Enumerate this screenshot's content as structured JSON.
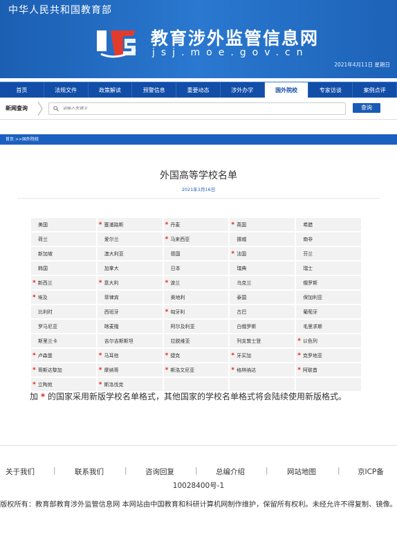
{
  "header": {
    "ministry": "中华人民共和国教育部",
    "site_title": "教育涉外监管信息网",
    "site_url": "jsj.moe.gov.cn",
    "date": "2021年4月11日 星期日",
    "banner_color": "#1b5fb2"
  },
  "nav": {
    "items": [
      "首页",
      "法规文件",
      "政策解读",
      "预警信息",
      "重要动态",
      "涉外办学",
      "国外院校",
      "专家访谈",
      "案例点评"
    ],
    "active": "国外院校"
  },
  "search": {
    "label": "新闻查询",
    "placeholder": "请输入关键字",
    "button": "查询"
  },
  "breadcrumb": "首页 >>国外院校",
  "article": {
    "title": "外国高等学校名单",
    "date": "2021年3月16日"
  },
  "countries": [
    [
      {
        "n": "美国",
        "s": false
      },
      {
        "n": "塞浦路斯",
        "s": true
      },
      {
        "n": "丹麦",
        "s": true
      },
      {
        "n": "英国",
        "s": true
      },
      {
        "n": "希腊",
        "s": false
      }
    ],
    [
      {
        "n": "荷兰",
        "s": false
      },
      {
        "n": "爱尔兰",
        "s": false
      },
      {
        "n": "马来西亚",
        "s": true
      },
      {
        "n": "挪威",
        "s": false
      },
      {
        "n": "南非",
        "s": false
      }
    ],
    [
      {
        "n": "新加坡",
        "s": false
      },
      {
        "n": "澳大利亚",
        "s": false
      },
      {
        "n": "德国",
        "s": false
      },
      {
        "n": "法国",
        "s": true
      },
      {
        "n": "芬兰",
        "s": false
      }
    ],
    [
      {
        "n": "韩国",
        "s": false
      },
      {
        "n": "加拿大",
        "s": false
      },
      {
        "n": "日本",
        "s": false
      },
      {
        "n": "瑞典",
        "s": false
      },
      {
        "n": "瑞士",
        "s": false
      }
    ],
    [
      {
        "n": "新西兰",
        "s": true
      },
      {
        "n": "意大利",
        "s": true
      },
      {
        "n": "波兰",
        "s": true
      },
      {
        "n": "乌克兰",
        "s": false
      },
      {
        "n": "俄罗斯",
        "s": false
      }
    ],
    [
      {
        "n": "埃及",
        "s": true
      },
      {
        "n": "菲律宾",
        "s": false
      },
      {
        "n": "奥地利",
        "s": false
      },
      {
        "n": "泰国",
        "s": false
      },
      {
        "n": "保加利亚",
        "s": false
      }
    ],
    [
      {
        "n": "比利时",
        "s": false
      },
      {
        "n": "西班牙",
        "s": false
      },
      {
        "n": "匈牙利",
        "s": true
      },
      {
        "n": "古巴",
        "s": false
      },
      {
        "n": "葡萄牙",
        "s": false
      }
    ],
    [
      {
        "n": "罗马尼亚",
        "s": false
      },
      {
        "n": "喀麦隆",
        "s": false
      },
      {
        "n": "阿尔及利亚",
        "s": false
      },
      {
        "n": "白俄罗斯",
        "s": false
      },
      {
        "n": "毛里求斯",
        "s": false
      }
    ],
    [
      {
        "n": "斯里兰卡",
        "s": false
      },
      {
        "n": "吉尔吉斯斯坦",
        "s": false
      },
      {
        "n": "拉脱维亚",
        "s": false
      },
      {
        "n": "列支敦士登",
        "s": false
      },
      {
        "n": "以色列",
        "s": true
      }
    ],
    [
      {
        "n": "卢森堡",
        "s": true
      },
      {
        "n": "马耳他",
        "s": true
      },
      {
        "n": "捷克",
        "s": true
      },
      {
        "n": "牙买加",
        "s": true
      },
      {
        "n": "克罗地亚",
        "s": true
      }
    ],
    [
      {
        "n": "哥斯达黎加",
        "s": true
      },
      {
        "n": "摩纳哥",
        "s": true
      },
      {
        "n": "斯洛文尼亚",
        "s": true
      },
      {
        "n": "格林纳达",
        "s": true
      },
      {
        "n": "阿联酋",
        "s": true
      }
    ],
    [
      {
        "n": "立陶宛",
        "s": true
      },
      {
        "n": "斯洛伐克",
        "s": true
      },
      {
        "n": "",
        "s": false
      },
      {
        "n": "",
        "s": false
      },
      {
        "n": "",
        "s": false
      }
    ]
  ],
  "note": {
    "prefix": "加",
    "star": "*",
    "text": "的国家采用新版学校名单格式，其他国家的学校名单格式将会陆续使用新版格式。"
  },
  "footer": {
    "links": [
      "关于我们",
      "联系我们",
      "咨询回复",
      "总编介绍",
      "网站地图",
      "京ICP备"
    ],
    "icp_line2": "10028400号-1",
    "copyright": "版权所有：教育部教育涉外监管信息网 本网站由中国教育和科研计算机网制作维护，保留所有权利。未经允许不得复制、镜像。"
  }
}
